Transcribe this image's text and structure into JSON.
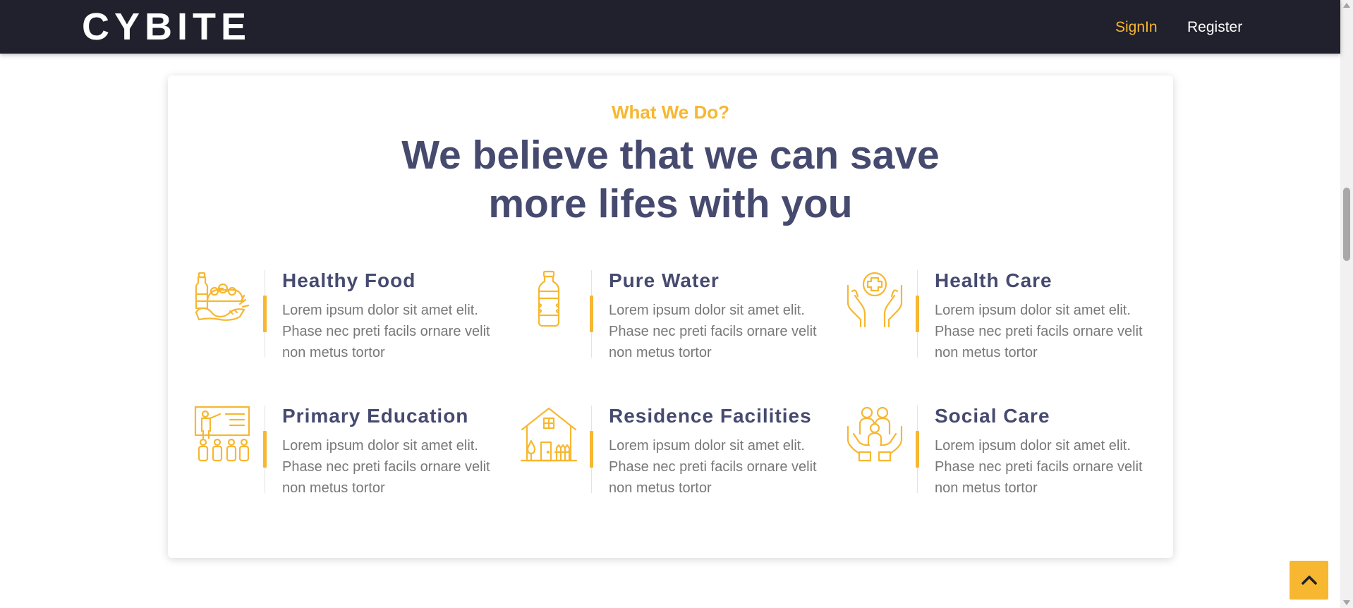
{
  "navbar": {
    "brand": "CYBITE",
    "signin_label": "SignIn",
    "register_label": "Register"
  },
  "section": {
    "eyebrow": "What We Do?",
    "headline_line1": "We believe that we can save",
    "headline_line2": "more lifes with you"
  },
  "services": [
    {
      "icon": "healthy-food-icon",
      "title": "Healthy Food",
      "description": "Lorem ipsum dolor sit amet elit. Phase nec preti facils ornare velit non metus tortor"
    },
    {
      "icon": "water-bottle-icon",
      "title": "Pure Water",
      "description": "Lorem ipsum dolor sit amet elit. Phase nec preti facils ornare velit non metus tortor"
    },
    {
      "icon": "health-care-icon",
      "title": "Health Care",
      "description": "Lorem ipsum dolor sit amet elit. Phase nec preti facils ornare velit non metus tortor"
    },
    {
      "icon": "teacher-classroom-icon",
      "title": "Primary Education",
      "description": "Lorem ipsum dolor sit amet elit. Phase nec preti facils ornare velit non metus tortor"
    },
    {
      "icon": "house-icon",
      "title": "Residence Facilities",
      "description": "Lorem ipsum dolor sit amet elit. Phase nec preti facils ornare velit non metus tortor"
    },
    {
      "icon": "family-care-icon",
      "title": "Social Care",
      "description": "Lorem ipsum dolor sit amet elit. Phase nec preti facils ornare velit non metus tortor"
    }
  ],
  "back_to_top": {
    "icon": "chevron-up-icon"
  },
  "colors": {
    "navbar_bg": "#21212d",
    "accent": "#f7b731",
    "heading": "#464a6f",
    "body_text": "#787878"
  }
}
